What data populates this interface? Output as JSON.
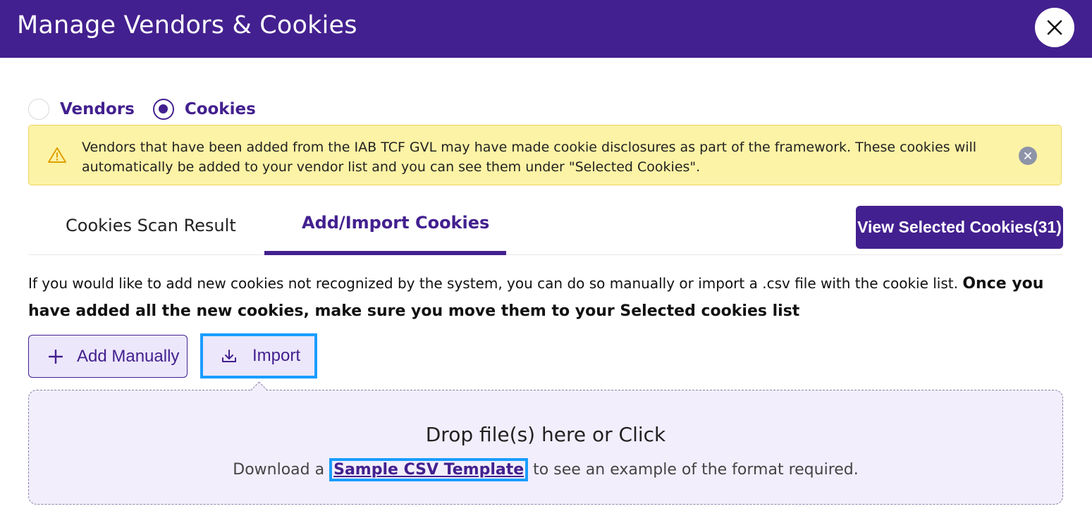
{
  "header": {
    "title": "Manage Vendors & Cookies",
    "close_icon": "close-icon"
  },
  "radio": {
    "options": [
      {
        "label": "Vendors",
        "checked": false
      },
      {
        "label": "Cookies",
        "checked": true
      }
    ]
  },
  "alert": {
    "icon": "warning-icon",
    "text": "Vendors that have been added from the IAB TCF GVL may have made cookie disclosures as part of the framework. These cookies will automatically be added to your vendor list and you can see them under \"Selected Cookies\".",
    "close_icon": "close-icon"
  },
  "tabs": [
    {
      "label": "Cookies Scan Result",
      "active": false
    },
    {
      "label": "Add/Import Cookies",
      "active": true
    }
  ],
  "view_selected_button": "View Selected Cookies(31)",
  "description": {
    "normal": "If you would like to add new cookies not recognized by the system, you can do so manually or import a .csv file with the cookie list.",
    "bold": "Once you have added all the new cookies, make sure you move them to your Selected cookies list"
  },
  "buttons": {
    "add_manually": "Add Manually",
    "import": "Import"
  },
  "dropzone": {
    "title": "Drop file(s) here or Click",
    "prefix": "Download a",
    "link": "Sample CSV Template",
    "suffix": "to see an example of the format required."
  },
  "colors": {
    "brand": "#43208f",
    "alert_bg": "#fcf3a6",
    "highlight": "#1a9dff"
  }
}
